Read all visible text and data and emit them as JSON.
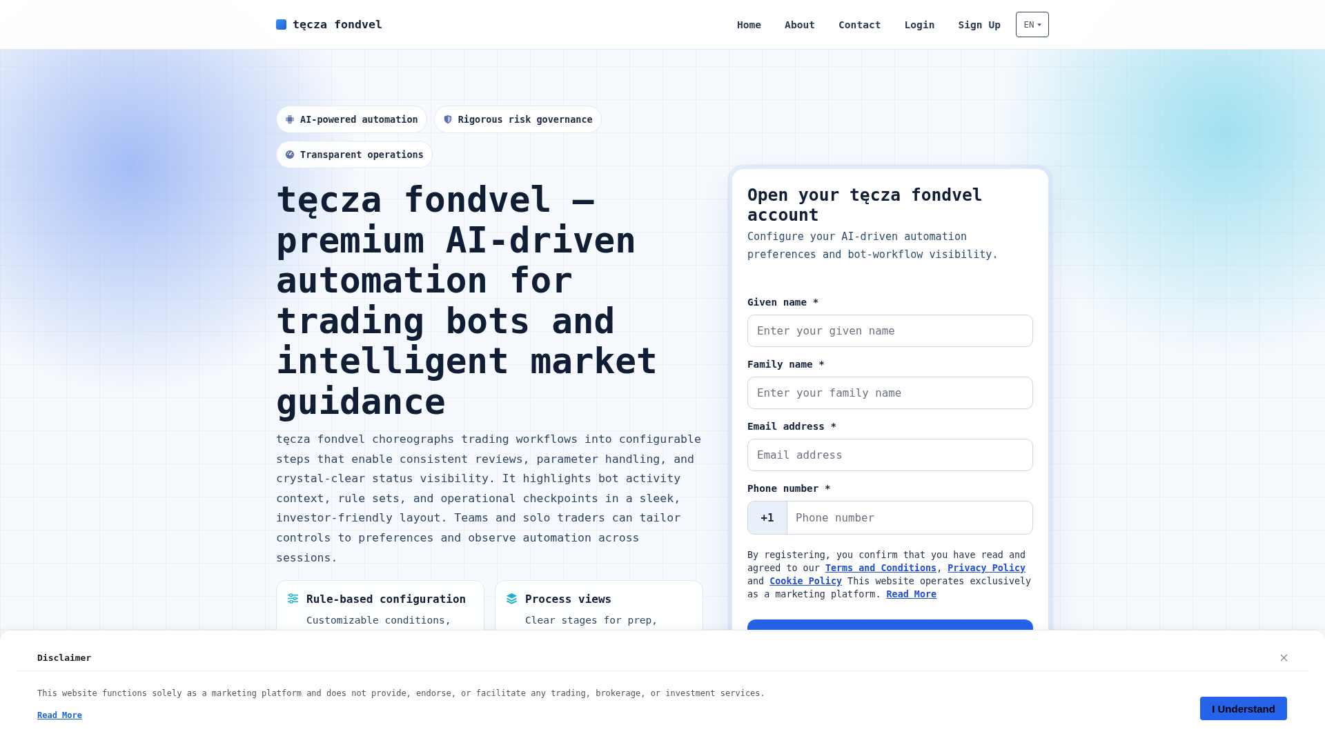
{
  "header": {
    "brand": "tęcza fondvel",
    "nav": [
      "Home",
      "About",
      "Contact",
      "Login",
      "Sign Up"
    ],
    "language": "EN"
  },
  "hero": {
    "badges": [
      "AI-powered automation",
      "Rigorous risk governance",
      "Transparent operations"
    ],
    "heading": "tęcza fondvel — premium AI-driven automation for trading bots and intelligent market guidance",
    "description": "tęcza fondvel choreographs trading workflows into configurable steps that enable consistent reviews, parameter handling, and crystal-clear status visibility. It highlights bot activity context, rule sets, and operational checkpoints in a sleek, investor-friendly layout. Teams and solo traders can tailor controls to preferences and observe automation across sessions.",
    "features": [
      {
        "title": "Rule-based configuration",
        "text": "Customizable conditions,"
      },
      {
        "title": "Process views",
        "text": "Clear stages for prep,"
      }
    ]
  },
  "signup": {
    "title": "Open your tęcza fondvel account",
    "subtitle": "Configure your AI-driven automation preferences and bot-workflow visibility.",
    "fields": [
      {
        "kind": "text",
        "label": "Given name *",
        "placeholder": "Enter your given name"
      },
      {
        "kind": "text",
        "label": "Family name *",
        "placeholder": "Enter your family name"
      },
      {
        "kind": "text",
        "label": "Email address *",
        "placeholder": "Email address"
      },
      {
        "kind": "phone",
        "label": "Phone number *",
        "prefix": "+1",
        "placeholder": "Phone number"
      }
    ],
    "consent": [
      {
        "kind": "text",
        "text": "By registering, you confirm that you have read and agreed to our "
      },
      {
        "kind": "link",
        "text": "Terms and Conditions"
      },
      {
        "kind": "text",
        "text": ", "
      },
      {
        "kind": "link",
        "text": "Privacy Policy"
      },
      {
        "kind": "text",
        "text": " and "
      },
      {
        "kind": "link",
        "text": "Cookie Policy"
      },
      {
        "kind": "text",
        "text": " This website operates exclusively as a marketing platform. "
      },
      {
        "kind": "link",
        "text": "Read More"
      }
    ]
  },
  "disclaimer": {
    "title": "Disclaimer",
    "text": "This website functions solely as a marketing platform and does not provide, endorse, or facilitate any trading, brokerage, or investment services.",
    "link": "Read More",
    "button": "I Understand"
  }
}
